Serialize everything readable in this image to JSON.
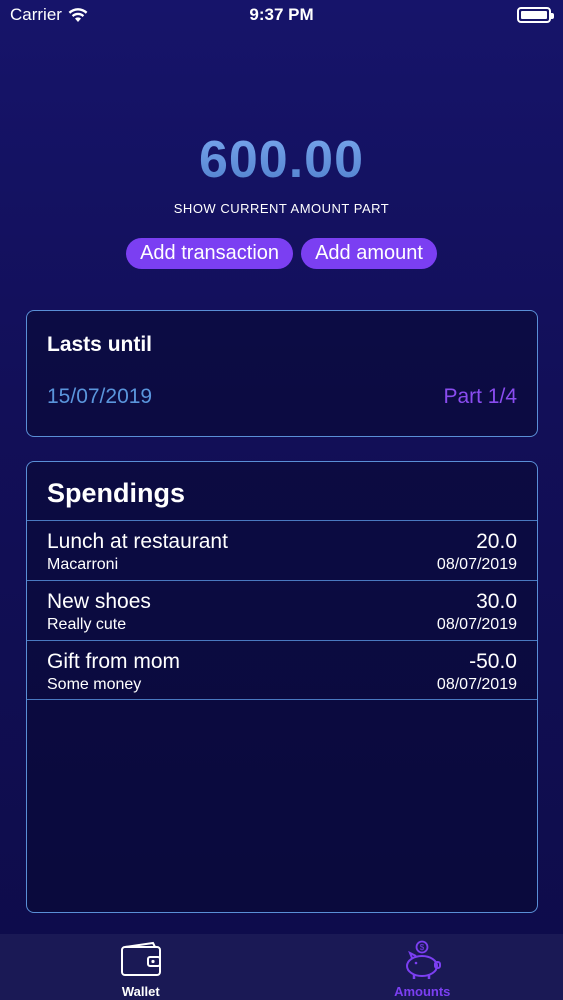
{
  "status_bar": {
    "carrier": "Carrier",
    "time": "9:37 PM"
  },
  "header": {
    "amount": "600.00",
    "caption": "SHOW CURRENT AMOUNT PART",
    "add_transaction_label": "Add transaction",
    "add_amount_label": "Add amount"
  },
  "lasts_card": {
    "title": "Lasts until",
    "date": "15/07/2019",
    "part": "Part 1/4"
  },
  "spendings": {
    "title": "Spendings",
    "items": [
      {
        "name": "Lunch at restaurant",
        "note": "Macarroni",
        "amount": "20.0",
        "date": "08/07/2019"
      },
      {
        "name": "New shoes",
        "note": "Really cute",
        "amount": "30.0",
        "date": "08/07/2019"
      },
      {
        "name": "Gift from mom",
        "note": "Some money",
        "amount": "-50.0",
        "date": "08/07/2019"
      }
    ]
  },
  "tab_bar": {
    "tabs": [
      {
        "label": "Wallet",
        "icon": "wallet-icon",
        "active": false
      },
      {
        "label": "Amounts",
        "icon": "piggy-bank-icon",
        "active": true
      }
    ]
  },
  "colors": {
    "background": "#15135e",
    "accent": "#7b3ff2",
    "amount_blue": "#5f8fd8",
    "card_border": "#5a8fd6"
  }
}
